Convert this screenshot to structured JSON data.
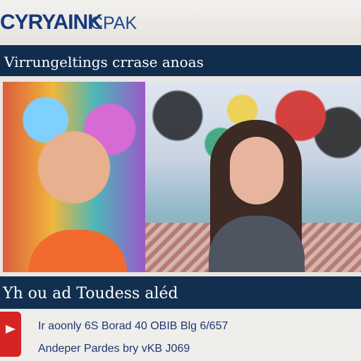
{
  "header": {
    "brand": "CYRYAINK",
    "brand_sub": "CPAK"
  },
  "top_bar": {
    "title": "Virrungeltings crrase anoas"
  },
  "caption": {
    "text": "Yh ou ad Toudess aléd"
  },
  "footer": {
    "line_1": "Ir aoonly 6S Borad 40 OBIB Blg 6/657",
    "line_2": "Andeper Pardes bry vKB J069"
  },
  "colors": {
    "header_bg": "#e9e6e1",
    "bar_bg": "#102d4e",
    "brand_blue": "#173a79",
    "logo_red": "#d62424"
  },
  "icons": {
    "logo": "play-icon"
  }
}
